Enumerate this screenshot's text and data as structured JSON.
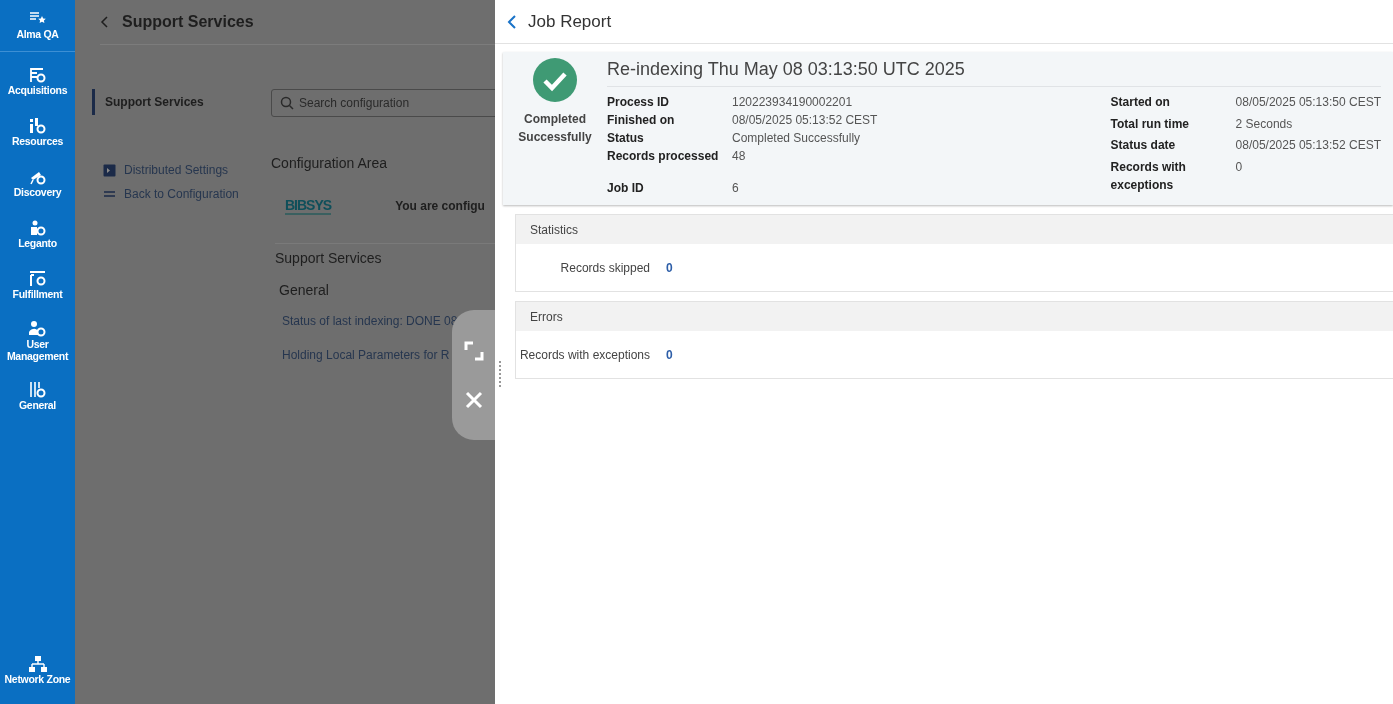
{
  "sidebar": {
    "items": [
      {
        "label": "Alma QA"
      },
      {
        "label": "Acquisitions"
      },
      {
        "label": "Resources"
      },
      {
        "label": "Discovery"
      },
      {
        "label": "Leganto"
      },
      {
        "label": "Fulfillment"
      },
      {
        "label": "User Management"
      },
      {
        "label": "General"
      }
    ],
    "footer": {
      "label": "Network Zone"
    }
  },
  "background_page": {
    "title": "Support Services",
    "nav": [
      {
        "label": "Support Services",
        "selected": true
      }
    ],
    "links": [
      "Distributed Settings",
      "Back to Configuration"
    ],
    "search": {
      "placeholder": "Search configuration"
    },
    "area_title": "Configuration Area",
    "logo": "BIBSYS",
    "configuring_text": "You are configu",
    "section_title": "Support Services",
    "group_title": "General",
    "items": [
      "Status of last indexing: DONE 08",
      "Holding Local Parameters for R"
    ]
  },
  "job_report": {
    "title": "Job Report",
    "status_label": "Completed Successfully",
    "heading": "Re-indexing Thu May 08 03:13:50 UTC 2025",
    "left_fields": [
      {
        "label": "Process ID",
        "value": "120223934190002201"
      },
      {
        "label": "Finished on",
        "value": "08/05/2025 05:13:52 CEST"
      },
      {
        "label": "Status",
        "value": "Completed Successfully"
      },
      {
        "label": "Records processed",
        "value": "48"
      },
      {
        "label": "Job ID",
        "value": "6"
      }
    ],
    "right_fields": [
      {
        "label": "Started on",
        "value": "08/05/2025 05:13:50 CEST"
      },
      {
        "label": "Total run time",
        "value": "2 Seconds"
      },
      {
        "label": "Status date",
        "value": "08/05/2025 05:13:52 CEST"
      },
      {
        "label": "Records with exceptions",
        "value": "0"
      }
    ],
    "sections": [
      {
        "title": "Statistics",
        "rows": [
          {
            "label": "Records skipped",
            "value": "0"
          }
        ]
      },
      {
        "title": "Errors",
        "rows": [
          {
            "label": "Records with exceptions",
            "value": "0"
          }
        ]
      }
    ]
  }
}
